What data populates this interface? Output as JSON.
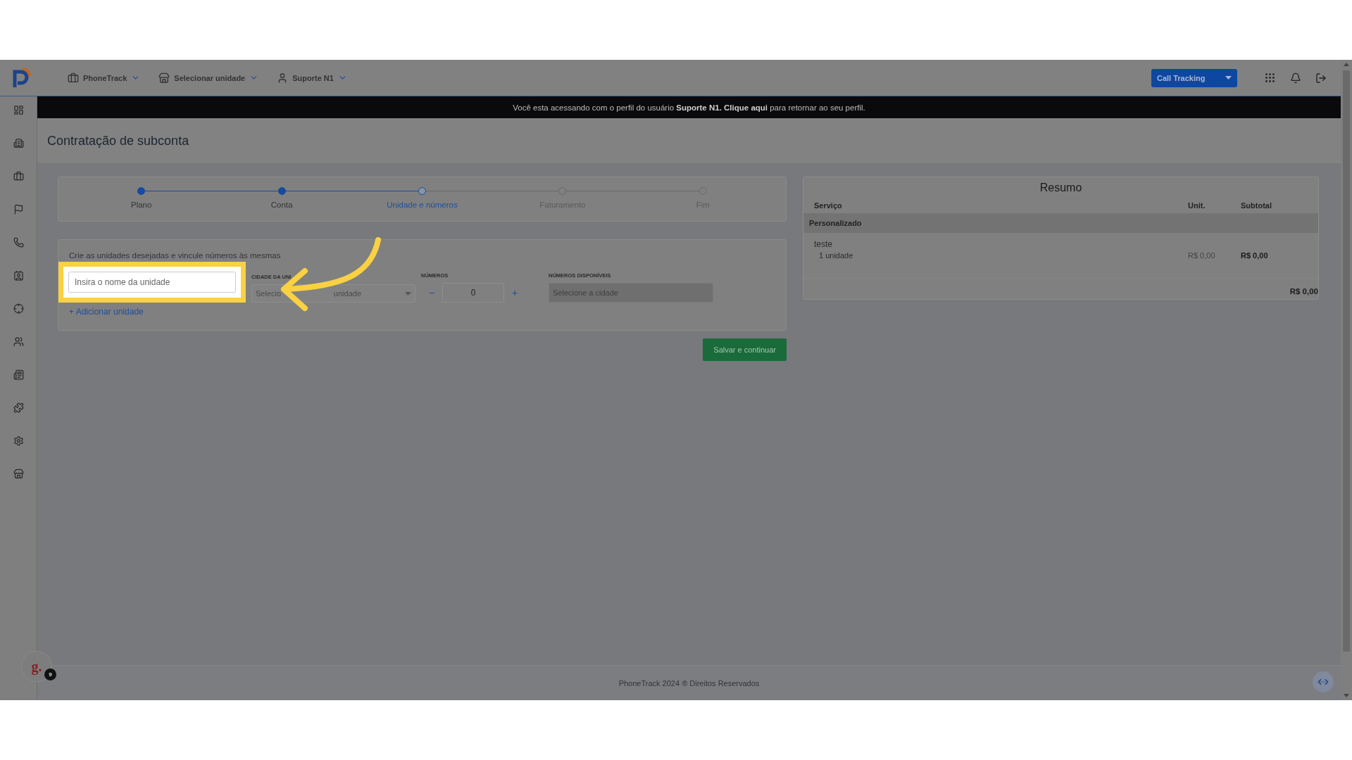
{
  "topbar": {
    "menus": [
      {
        "kind": "briefcase",
        "label": "PhoneTrack"
      },
      {
        "kind": "store",
        "label": "Selecionar unidade"
      },
      {
        "kind": "user",
        "label": "Suporte N1"
      }
    ],
    "product": "Call Tracking"
  },
  "banner": "Você esta acessando com o perfil do usuário **Suporte N1. Clique aqui** para retornar ao seu perfil.",
  "page_title": "Contratação de subconta",
  "steps": [
    {
      "label": "Plano",
      "completed": true,
      "selected": false
    },
    {
      "label": "Conta",
      "completed": true,
      "selected": false
    },
    {
      "label": "Unidade e números",
      "completed": false,
      "selected": true
    },
    {
      "label": "Faturamento",
      "completed": false,
      "selected": false
    },
    {
      "label": "Fim",
      "completed": false,
      "selected": false
    }
  ],
  "form": {
    "hint": "Crie as unidades desejadas e vincule números às mesmas",
    "fields": [
      {
        "kind": "text",
        "placeholder": "Insira o nome da unidade",
        "highlighted": true
      },
      {
        "kind": "select",
        "label": "CIDADE DA UNI",
        "placeholder_start": "Selecio",
        "placeholder_end": "unidade"
      },
      {
        "kind": "counter",
        "label": "NÚMEROS",
        "minus": "−",
        "value": "0",
        "plus": "+"
      },
      {
        "kind": "readonly",
        "label": "NÚMEROS DISPONÍVEIS",
        "placeholder": "Selecione a cidade"
      }
    ],
    "add_link": "+ Adicionar unidade",
    "submit": "Salvar e continuar"
  },
  "summary": {
    "title": "Resumo",
    "columns": [
      "Serviço",
      "Unit.",
      "Subtotal"
    ],
    "group": "Personalizado",
    "items": [
      {
        "name": "teste",
        "detail": "1 unidade",
        "unit": "R$ 0,00",
        "subtotal": "R$ 0,00"
      }
    ],
    "total": "R$ 0,00"
  },
  "footer": "PhoneTrack 2024 ® Direitos Reservados",
  "widget": {
    "letter": "g.",
    "badge": "9"
  }
}
